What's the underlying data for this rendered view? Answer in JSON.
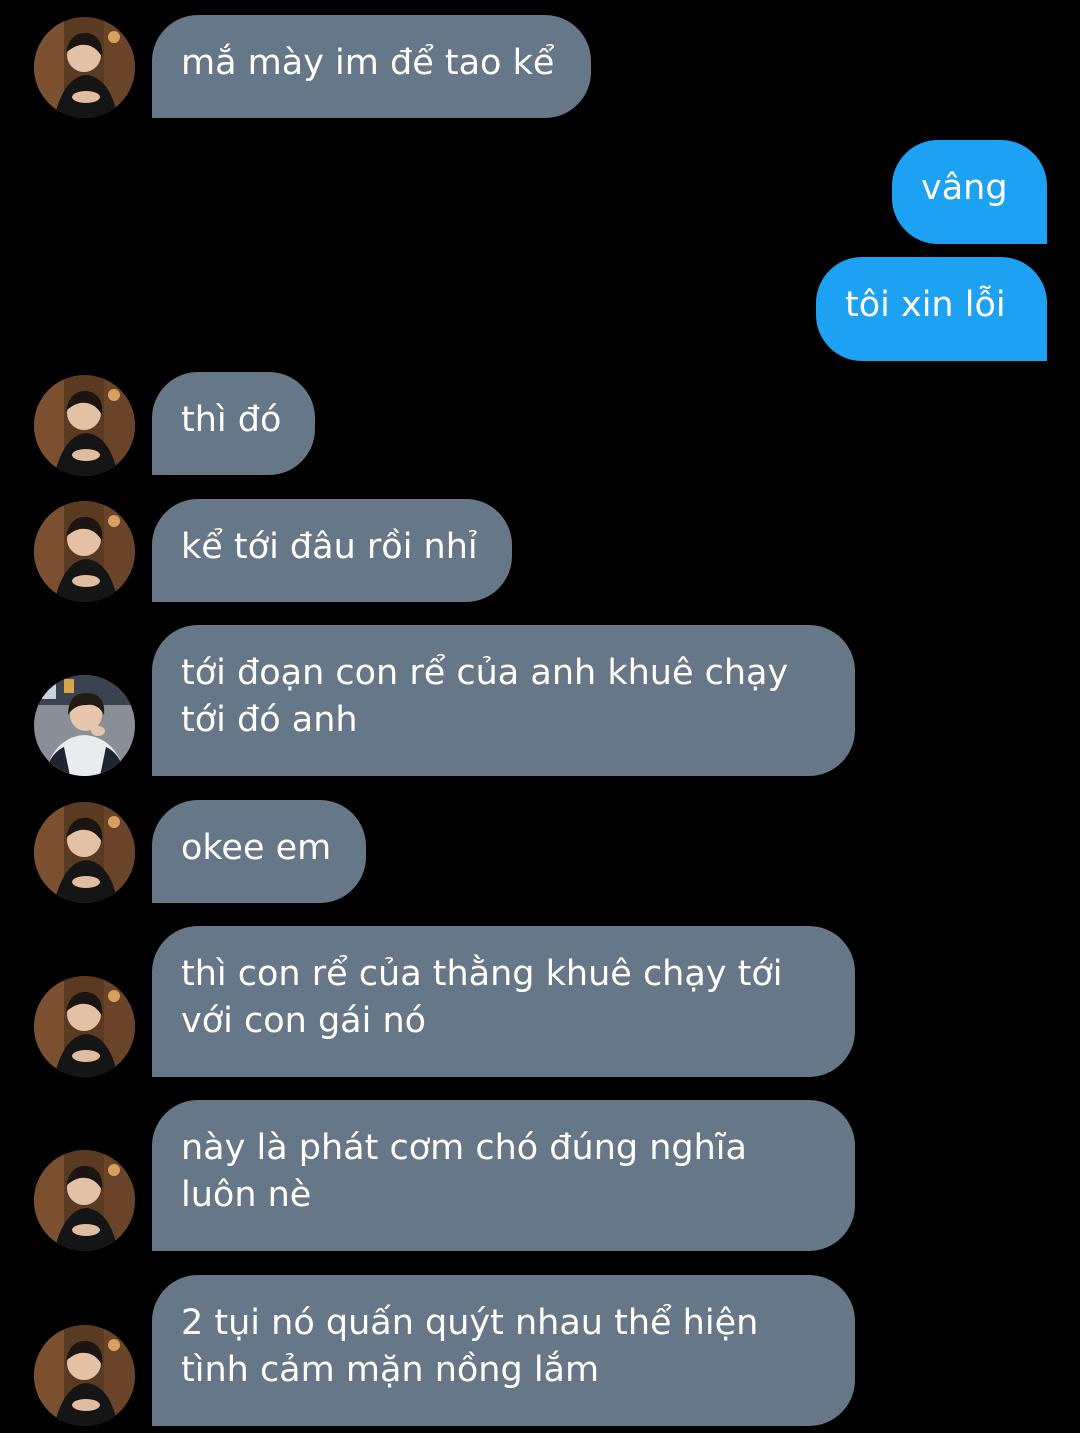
{
  "conversation": {
    "colors": {
      "background": "#000000",
      "incoming_bubble": "#667787",
      "outgoing_bubble": "#1da1f2",
      "text": "#ffffff"
    },
    "messages": [
      {
        "sender": "other",
        "lines": [
          "mắ mày im để tao kể"
        ]
      },
      {
        "sender": "me",
        "lines": [
          "vâng"
        ]
      },
      {
        "sender": "me",
        "lines": [
          "tôi xin lỗi"
        ]
      },
      {
        "sender": "other",
        "lines": [
          "thì đó"
        ]
      },
      {
        "sender": "other",
        "lines": [
          "kể tới đâu rồi nhỉ"
        ]
      },
      {
        "sender": "other-2",
        "lines": [
          "tới đoạn con rể của anh khuê chạy",
          "tới đó anh"
        ]
      },
      {
        "sender": "other",
        "lines": [
          "okee em"
        ]
      },
      {
        "sender": "other",
        "lines": [
          "thì con rể của thằng khuê chạy tới",
          "với con gái nó"
        ]
      },
      {
        "sender": "other",
        "lines": [
          "này là phát cơm chó đúng nghĩa",
          "luôn nè"
        ]
      },
      {
        "sender": "other",
        "lines": [
          "2 tụi nó quấn quýt nhau thể hiện",
          "tình cảm mặn nồng lắm"
        ]
      }
    ]
  }
}
